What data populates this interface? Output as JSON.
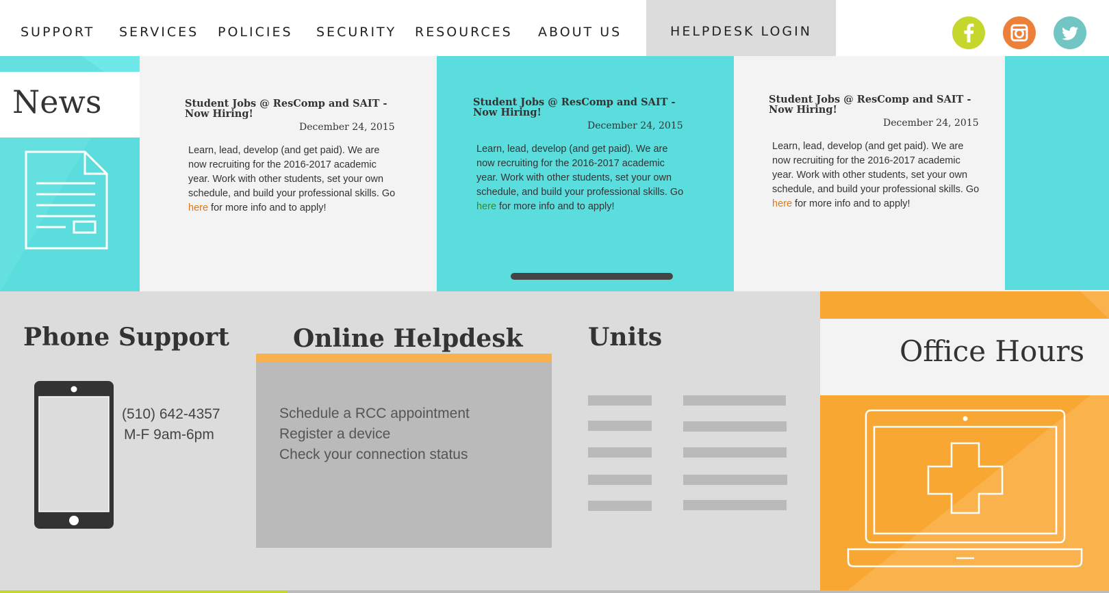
{
  "nav": {
    "items": [
      {
        "label": "SUPPORT"
      },
      {
        "label": "SERVICES"
      },
      {
        "label": "POLICIES"
      },
      {
        "label": "SECURITY"
      },
      {
        "label": "RESOURCES"
      },
      {
        "label": "ABOUT US"
      }
    ],
    "login_label": "HELPDESK LOGIN",
    "social": [
      {
        "icon": "facebook-icon",
        "color": "#c5d62c"
      },
      {
        "icon": "instagram-icon",
        "color": "#ec7f3a"
      },
      {
        "icon": "twitter-icon",
        "color": "#71c6c4"
      }
    ]
  },
  "news": {
    "label": "News",
    "icon": "document-icon",
    "accent": "#64e0e1",
    "cards": [
      {
        "title": "Student Jobs @ ResComp and SAIT - Now Hiring!",
        "date": "December 24, 2015",
        "body_before": "Learn, lead, develop (and get paid). We are now recruiting for the 2016-2017 academic year. Work with other students, set your own schedule, and build your professional skills. Go ",
        "link": "here",
        "body_after": " for more info and to apply!"
      },
      {
        "title": "Student Jobs @ ResComp and SAIT - Now Hiring!",
        "date": "December 24, 2015",
        "body_before": "Learn, lead, develop (and get paid). We are now recruiting for the 2016-2017 academic year. Work with other students, set your own schedule, and build your professional skills. Go ",
        "link": "here",
        "body_after": " for more info and to apply!"
      },
      {
        "title": "Student Jobs @ ResComp and SAIT - Now Hiring!",
        "date": "December 24, 2015",
        "body_before": "Learn, lead, develop (and get paid). We are now recruiting for the 2016-2017 academic year. Work with other students, set your own schedule, and build your professional skills. Go ",
        "link": "here",
        "body_after": " for more info and to apply!"
      }
    ]
  },
  "phone": {
    "title": "Phone Support",
    "number": "(510) 642-4357",
    "hours": "M-F 9am-6pm",
    "icon": "smartphone-icon"
  },
  "helpdesk": {
    "title": "Online Helpdesk",
    "links": [
      "Schedule a RCC appointment",
      "Register a device",
      "Check your connection status"
    ]
  },
  "units": {
    "title": "Units"
  },
  "office": {
    "title": "Office Hours",
    "icon": "laptop-medical-icon",
    "accent": "#f7a732"
  }
}
